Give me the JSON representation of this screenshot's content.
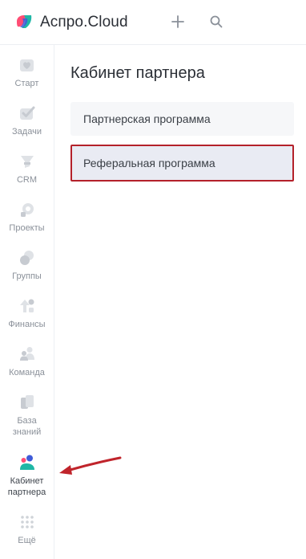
{
  "header": {
    "brand": "Аспро.Cloud",
    "logo_icon": "aspro-cloud-logo",
    "plus_icon": "plus-icon",
    "search_icon": "search-icon"
  },
  "sidebar": {
    "items": [
      {
        "label": "Старт",
        "icon": "heart-icon"
      },
      {
        "label": "Задачи",
        "icon": "checkmark-icon"
      },
      {
        "label": "CRM",
        "icon": "funnel-icon"
      },
      {
        "label": "Проекты",
        "icon": "projects-icon"
      },
      {
        "label": "Группы",
        "icon": "groups-icon"
      },
      {
        "label": "Финансы",
        "icon": "finance-icon"
      },
      {
        "label": "Команда",
        "icon": "team-icon"
      },
      {
        "label": "База знаний",
        "icon": "knowledge-base-icon"
      },
      {
        "label": "Кабинет партнера",
        "icon": "partner-cabinet-icon",
        "active": true
      },
      {
        "label": "Ещё",
        "icon": "more-dots-icon"
      }
    ]
  },
  "main": {
    "title": "Кабинет партнера",
    "menu": [
      {
        "label": "Партнерская программа",
        "selected": false
      },
      {
        "label": "Реферальная программа",
        "selected": true
      }
    ]
  },
  "colors": {
    "highlight_border": "#b4212a",
    "annotation_arrow": "#c0242b",
    "icon_gray": "#dfe2e6",
    "accent_pink": "#ff4d74",
    "accent_teal": "#1fb7a6",
    "accent_blue": "#3f5bd8"
  }
}
